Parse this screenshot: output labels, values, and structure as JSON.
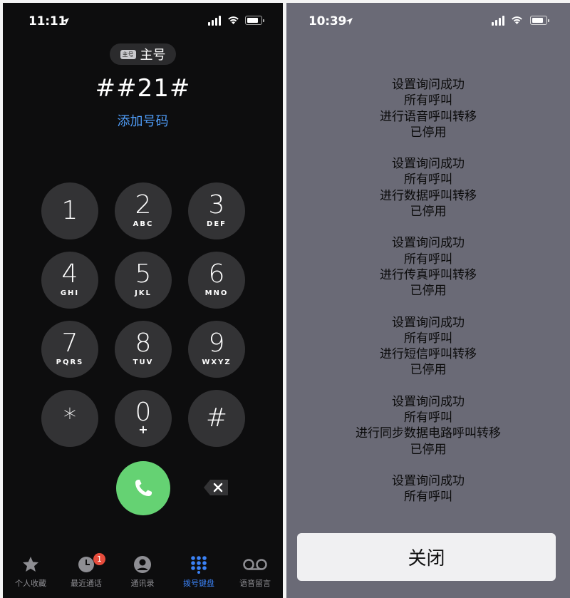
{
  "left": {
    "status": {
      "time": "11:11"
    },
    "line_chip": {
      "sim_badge": "主号",
      "label": "主号"
    },
    "number": "##21#",
    "add_number": "添加号码",
    "keys": [
      {
        "digit": "1",
        "letters": ""
      },
      {
        "digit": "2",
        "letters": "ABC"
      },
      {
        "digit": "3",
        "letters": "DEF"
      },
      {
        "digit": "4",
        "letters": "GHI"
      },
      {
        "digit": "5",
        "letters": "JKL"
      },
      {
        "digit": "6",
        "letters": "MNO"
      },
      {
        "digit": "7",
        "letters": "PQRS"
      },
      {
        "digit": "8",
        "letters": "TUV"
      },
      {
        "digit": "9",
        "letters": "WXYZ"
      },
      {
        "digit": "*",
        "letters": ""
      },
      {
        "digit": "0",
        "letters": "+"
      },
      {
        "digit": "#",
        "letters": ""
      }
    ],
    "tabs": [
      {
        "label": "个人收藏",
        "icon": "star-icon"
      },
      {
        "label": "最近通话",
        "icon": "clock-icon",
        "badge": "1"
      },
      {
        "label": "通讯录",
        "icon": "contacts-icon"
      },
      {
        "label": "拨号键盘",
        "icon": "keypad-icon",
        "active": true
      },
      {
        "label": "语音留言",
        "icon": "voicemail-icon"
      }
    ],
    "colors": {
      "accent": "#3b82f6",
      "call": "#65d273",
      "key_bg": "#333335",
      "link": "#4f9cf7"
    }
  },
  "right": {
    "status": {
      "time": "10:39"
    },
    "messages": [
      [
        "设置询问成功",
        "所有呼叫",
        "进行语音呼叫转移",
        "已停用"
      ],
      [
        "设置询问成功",
        "所有呼叫",
        "进行数据呼叫转移",
        "已停用"
      ],
      [
        "设置询问成功",
        "所有呼叫",
        "进行传真呼叫转移",
        "已停用"
      ],
      [
        "设置询问成功",
        "所有呼叫",
        "进行短信呼叫转移",
        "已停用"
      ],
      [
        "设置询问成功",
        "所有呼叫",
        "进行同步数据电路呼叫转移",
        "已停用"
      ],
      [
        "设置询问成功",
        "所有呼叫"
      ]
    ],
    "close_label": "关闭",
    "colors": {
      "background": "#6a6a76",
      "button": "#f0f0f2"
    }
  }
}
